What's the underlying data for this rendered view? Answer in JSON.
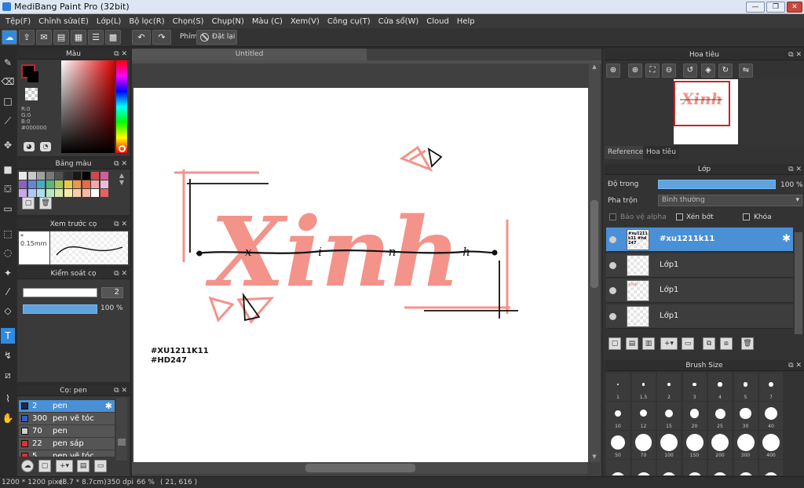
{
  "window": {
    "title": "MediBang Paint Pro (32bit)",
    "minimize": "—",
    "restore": "❐",
    "close": "✕"
  },
  "menu": [
    "Tệp(F)",
    "Chỉnh sửa(E)",
    "Lớp(L)",
    "Bộ lọc(R)",
    "Chọn(S)",
    "Chụp(N)",
    "Màu (C)",
    "Xem(V)",
    "Công cụ(T)",
    "Cửa sổ(W)",
    "Cloud",
    "Help"
  ],
  "toolbar": {
    "shortcut_label": "Phím",
    "reset_label": "Đặt lại"
  },
  "document": {
    "tab_title": "Untitled"
  },
  "color_panel": {
    "title": "Màu",
    "r": "R:0",
    "g": "G:0",
    "b": "B:0",
    "hex": "#000000",
    "primary": "#000000",
    "secondary": "#ffffff",
    "accent": "#c0262e"
  },
  "swatch_panel": {
    "title": "Bảng màu",
    "colors": [
      "#e8e8e8",
      "#c8c8c8",
      "#a0a0a0",
      "#787878",
      "#505050",
      "#303030",
      "#181818",
      "#000000",
      "#d04848",
      "#d0609c",
      "#9060c0",
      "#6088d0",
      "#48a8c8",
      "#58b878",
      "#a8c858",
      "#e8c848",
      "#e89848",
      "#e86848",
      "#f0a8a8",
      "#f0b8d8",
      "#c8a8e8",
      "#b0c8f0",
      "#a8e0e8",
      "#b8e8c0",
      "#d8e8a8",
      "#f8e8a8",
      "#f8d0a8",
      "#f8b8a8",
      "#ffffff",
      "#e86060"
    ]
  },
  "preview_panel": {
    "title": "Xem trước cọ",
    "size": "* 0.15mm"
  },
  "brush_control": {
    "title": "Kiểm soát cọ",
    "size_value": "2",
    "opacity_value": "100 %",
    "opacity": 1.0
  },
  "brush_list": {
    "title": "Cọ: pen",
    "items": [
      {
        "size": "2",
        "name": "pen",
        "color": "#1a2a4a",
        "selected": true
      },
      {
        "size": "300",
        "name": "pen vẽ tóc",
        "color": "#2f5fd0",
        "selected": false
      },
      {
        "size": "70",
        "name": "pen",
        "color": "#d0d0d0",
        "selected": false
      },
      {
        "size": "22",
        "name": "pen sáp",
        "color": "#e03030",
        "selected": false
      },
      {
        "size": "5",
        "name": "pen vẽ tóc",
        "color": "#e03030",
        "selected": false
      }
    ]
  },
  "canvas_art": {
    "word": "Xinh",
    "hand_text": "x i n h",
    "tag1": "#XU1211K11",
    "tag2": "#HD247",
    "pink": "#f3938a"
  },
  "navigator": {
    "title": "Hoa tiêu",
    "mini_word": "Xinh"
  },
  "tabs": {
    "reference": "Reference",
    "navigator": "Hoa tiêu"
  },
  "layer_panel": {
    "title": "Lớp",
    "opacity_label": "Độ trong",
    "opacity_value": "100 %",
    "opacity": 1.0,
    "blend_label": "Pha trộn",
    "blend_value": "Bình thường",
    "protect_alpha": "Bảo vệ alpha",
    "clip": "Xén bớt",
    "lock": "Khóa",
    "layers": [
      {
        "name": "#xu1211k11",
        "selected": true,
        "thumb": "#xu1211k11 #hd247"
      },
      {
        "name": "Lớp1",
        "selected": false,
        "thumb": ""
      },
      {
        "name": "Lớp1",
        "selected": false,
        "thumb": "xinh"
      },
      {
        "name": "Lớp1",
        "selected": false,
        "thumb": ""
      }
    ]
  },
  "brush_size_panel": {
    "title": "Brush Size",
    "sizes": [
      "1",
      "1.5",
      "2",
      "3",
      "4",
      "5",
      "7",
      "10",
      "12",
      "15",
      "20",
      "25",
      "30",
      "40",
      "50",
      "70",
      "100",
      "150",
      "200",
      "300",
      "400"
    ]
  },
  "status": {
    "pixels": "1200 * 1200 pixel",
    "cm": "(8.7 * 8.7cm)",
    "dpi": "350 dpi",
    "zoom": "66 %",
    "coords": "( 21, 616 )"
  }
}
